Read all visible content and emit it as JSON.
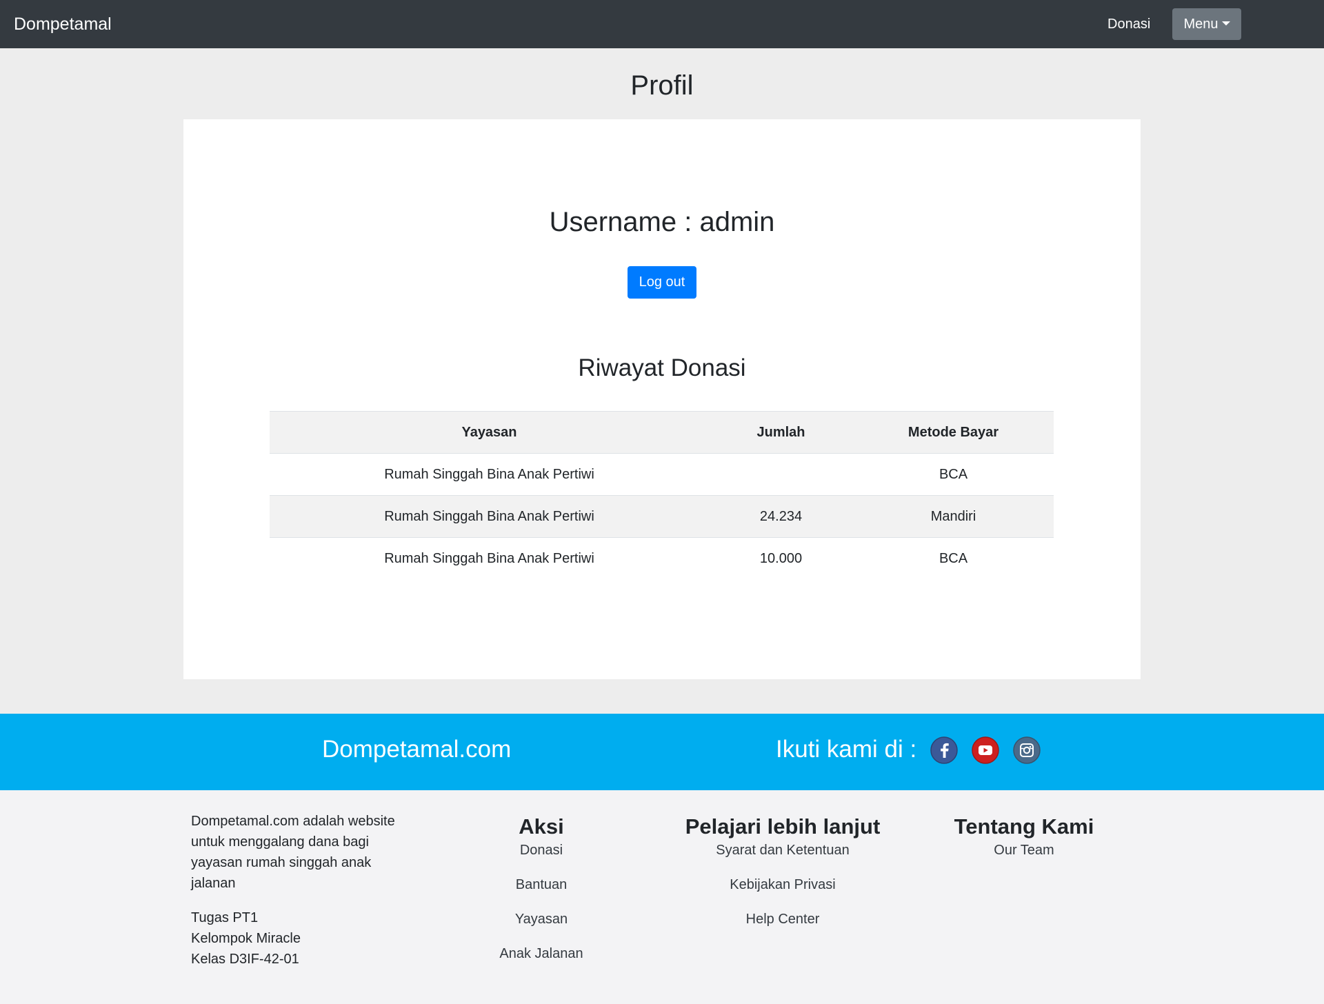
{
  "navbar": {
    "brand": "Dompetamal",
    "donasi_link": "Donasi",
    "menu_label": "Menu"
  },
  "page": {
    "title": "Profil"
  },
  "profile": {
    "username_text": "Username : admin",
    "logout_label": "Log out"
  },
  "history": {
    "title": "Riwayat Donasi",
    "headers": [
      "Yayasan",
      "Jumlah",
      "Metode Bayar"
    ],
    "rows": [
      [
        "Rumah Singgah Bina Anak Pertiwi",
        "",
        "BCA"
      ],
      [
        "Rumah Singgah Bina Anak Pertiwi",
        "24.234",
        "Mandiri"
      ],
      [
        "Rumah Singgah Bina Anak Pertiwi",
        "10.000",
        "BCA"
      ]
    ]
  },
  "band": {
    "site_name": "Dompetamal.com",
    "follow_text": "Ikuti kami di :",
    "social_icons": [
      "facebook-icon",
      "youtube-icon",
      "instagram-icon"
    ],
    "colors": {
      "band": "#00adef",
      "facebook": "#3b5998",
      "youtube": "#cd201f",
      "instagram": "#4a6a8a"
    }
  },
  "footer": {
    "about": "Dompetamal.com adalah website untuk menggalang dana bagi yayasan rumah singgah anak jalanan",
    "info_lines": [
      "Tugas PT1",
      "Kelompok Miracle",
      "Kelas D3IF-42-01"
    ],
    "aksi": {
      "title": "Aksi",
      "links": [
        "Donasi",
        "Bantuan",
        "Yayasan",
        "Anak Jalanan"
      ]
    },
    "pelajari": {
      "title": "Pelajari lebih lanjut",
      "links": [
        "Syarat dan Ketentuan",
        "Kebijakan Privasi",
        "Help Center"
      ]
    },
    "tentang": {
      "title": "Tentang Kami",
      "links": [
        "Our Team"
      ]
    }
  }
}
